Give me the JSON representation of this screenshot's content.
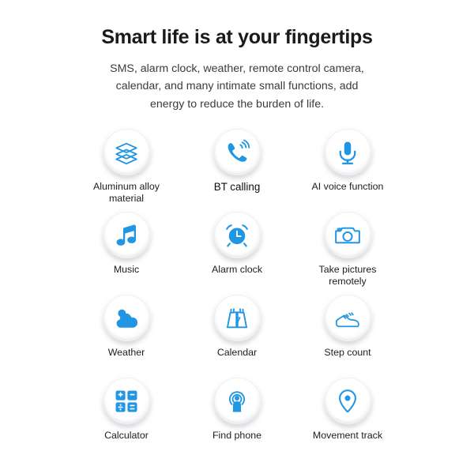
{
  "header": {
    "title": "Smart life is at your fingertips",
    "subtitle": "SMS, alarm clock, weather, remote control camera, calendar, and many intimate small functions, add energy to reduce the burden of life."
  },
  "theme": {
    "icon_blue": "#2196e3",
    "icon_blue_dark": "#1b83cf",
    "background": "#ffffff",
    "title_color": "#1a1a1a",
    "label_color": "#1d1d1d"
  },
  "features": [
    {
      "icon": "layers-icon",
      "label": "Aluminum alloy material",
      "emphasis": false
    },
    {
      "icon": "phone-calling-icon",
      "label": "BT calling",
      "emphasis": true
    },
    {
      "icon": "microphone-icon",
      "label": "AI voice function",
      "emphasis": false
    },
    {
      "icon": "music-note-icon",
      "label": "Music",
      "emphasis": false
    },
    {
      "icon": "alarm-clock-icon",
      "label": "Alarm clock",
      "emphasis": false
    },
    {
      "icon": "camera-icon",
      "label": "Take pictures remotely",
      "emphasis": false
    },
    {
      "icon": "weather-cloud-icon",
      "label": "Weather",
      "emphasis": false
    },
    {
      "icon": "calendar-icon",
      "label": "Calendar",
      "emphasis": false,
      "icon_text": "7"
    },
    {
      "icon": "sneaker-icon",
      "label": "Step count",
      "emphasis": false
    },
    {
      "icon": "calculator-icon",
      "label": "Calculator",
      "emphasis": false,
      "icon_keys": [
        "+",
        "−",
        "÷",
        "="
      ]
    },
    {
      "icon": "find-phone-icon",
      "label": "Find phone",
      "emphasis": false
    },
    {
      "icon": "map-pin-icon",
      "label": "Movement track",
      "emphasis": false
    }
  ]
}
